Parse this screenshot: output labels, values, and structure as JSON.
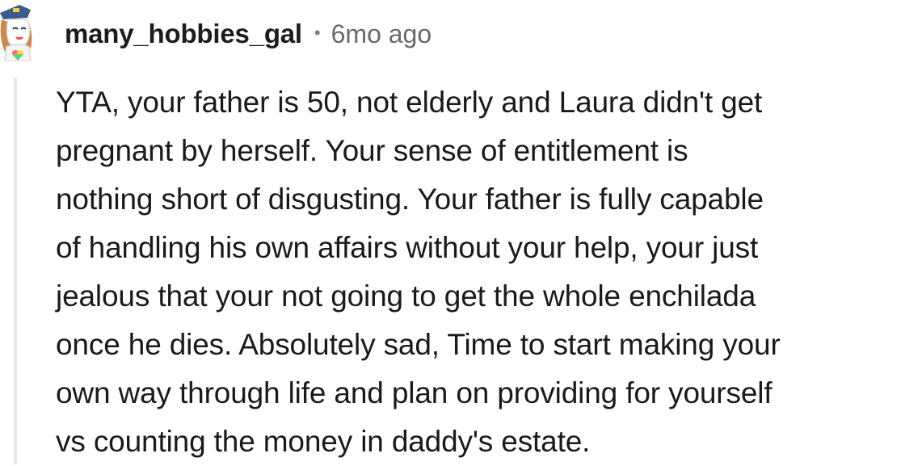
{
  "comment": {
    "author": "many_hobbies_gal",
    "separator": "•",
    "timestamp": "6mo ago",
    "avatar_icon": "cartoon-avatar-icon",
    "body_lines": [
      "YTA, your father is 50, not elderly and Laura didn't get",
      "pregnant by herself. Your sense of entitlement is",
      "nothing short of disgusting. Your father is fully capable",
      "of handling his own affairs without your help, your just",
      "jealous that your not going to get the whole enchilada",
      "once he dies. Absolutely sad, Time to start making your",
      "own way through life and plan on providing for yourself",
      "vs counting the money in daddy's estate."
    ]
  },
  "colors": {
    "text": "#1a1a1b",
    "meta": "#6a6a6a",
    "thread_line": "#e7e7e7",
    "background": "#ffffff"
  }
}
